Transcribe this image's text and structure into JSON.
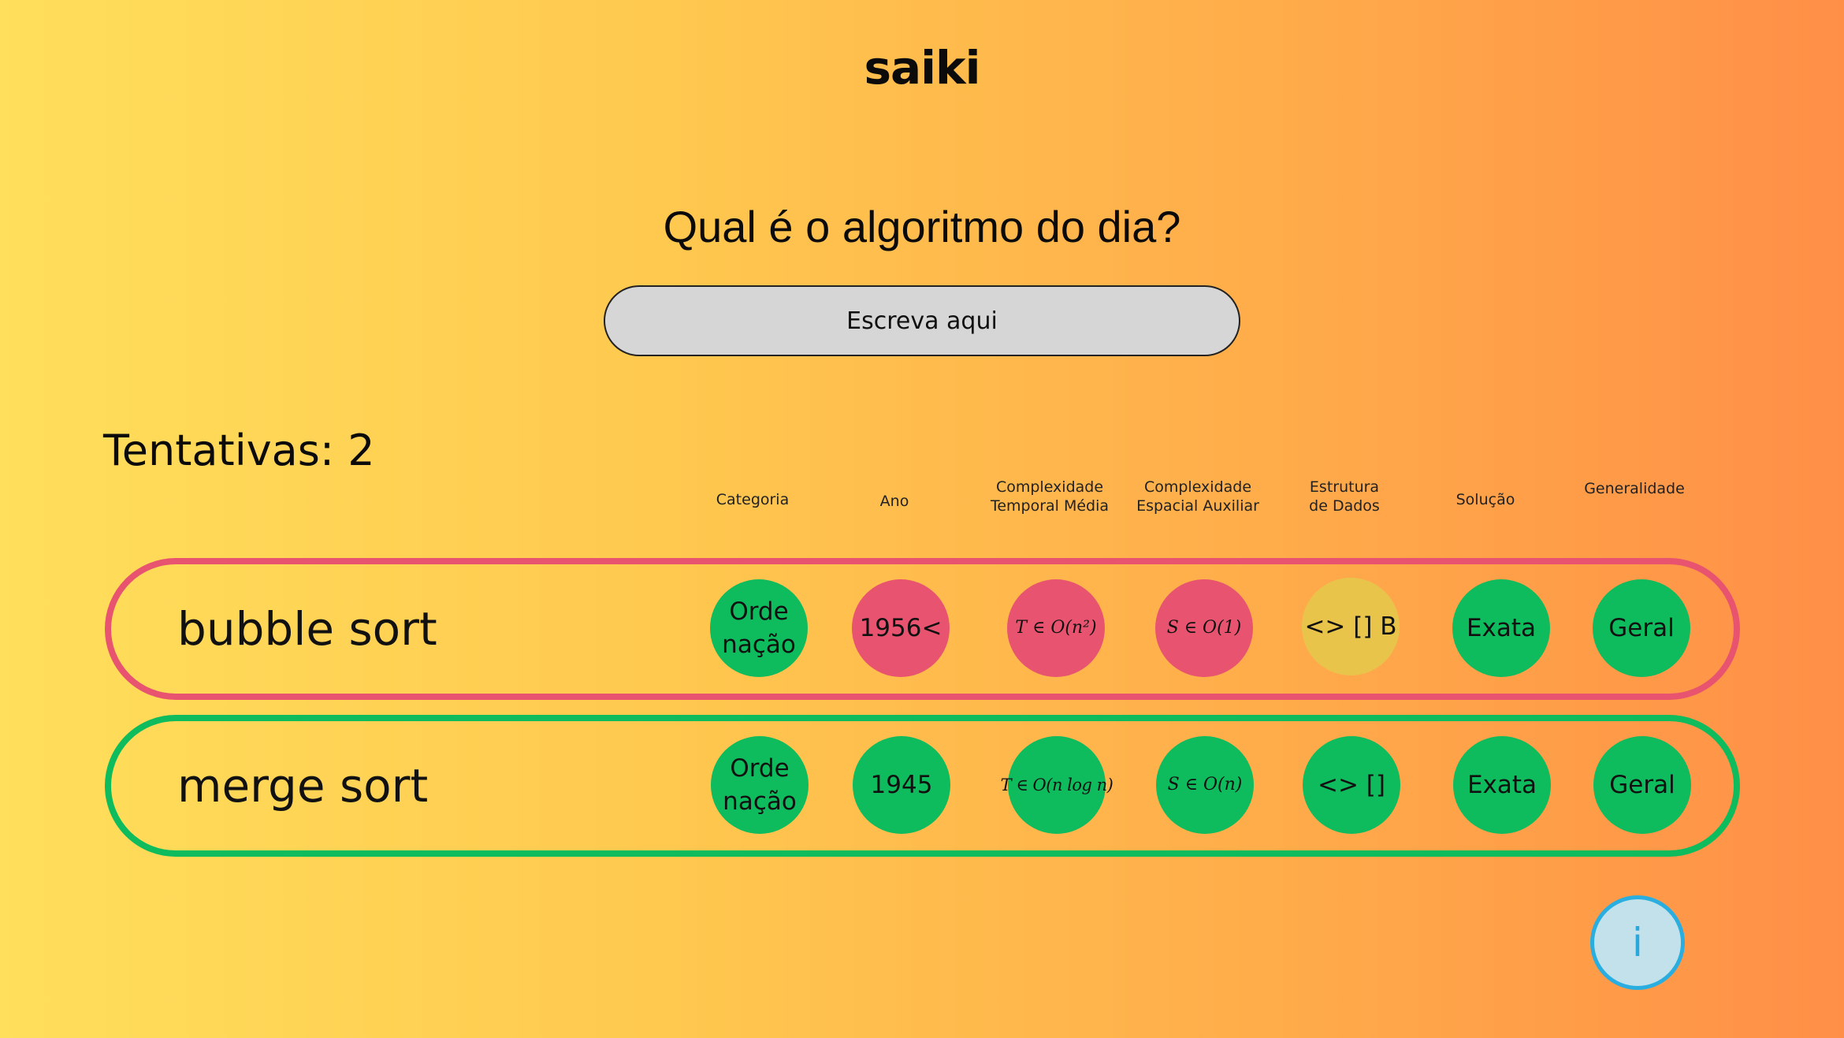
{
  "app": {
    "logo": "saiki"
  },
  "question": "Qual é o algoritmo do dia?",
  "search": {
    "placeholder": "Escreva aqui",
    "value": ""
  },
  "attempts_label": "Tentativas: 2",
  "columns": [
    "Categoria",
    "Ano",
    "Complexidade\nTemporal Média",
    "Complexidade\nEspacial Auxiliar",
    "Estrutura\nde Dados",
    "Solução",
    "Generalidade"
  ],
  "colors": {
    "match": "#0ebb5d",
    "wrong": "#e8546f",
    "partial": "#e8c54a",
    "info": "#2aaee0"
  },
  "guesses": [
    {
      "name": "bubble sort",
      "status": "wrong",
      "cells": [
        {
          "text": "Orde\nnação",
          "status": "match"
        },
        {
          "text": "1956<",
          "status": "wrong"
        },
        {
          "text": "T ∈ O(n²)",
          "status": "wrong"
        },
        {
          "text": "S ∈ O(1)",
          "status": "wrong"
        },
        {
          "text": "<> [] B",
          "status": "partial"
        },
        {
          "text": "Exata",
          "status": "match"
        },
        {
          "text": "Geral",
          "status": "match"
        }
      ]
    },
    {
      "name": "merge sort",
      "status": "match",
      "cells": [
        {
          "text": "Orde\nnação",
          "status": "match"
        },
        {
          "text": "1945",
          "status": "match"
        },
        {
          "text": "T ∈ O(n log n)",
          "status": "match"
        },
        {
          "text": "S ∈ O(n)",
          "status": "match"
        },
        {
          "text": "<> []",
          "status": "match"
        },
        {
          "text": "Exata",
          "status": "match"
        },
        {
          "text": "Geral",
          "status": "match"
        }
      ]
    }
  ],
  "info_button": {
    "label": "i"
  }
}
